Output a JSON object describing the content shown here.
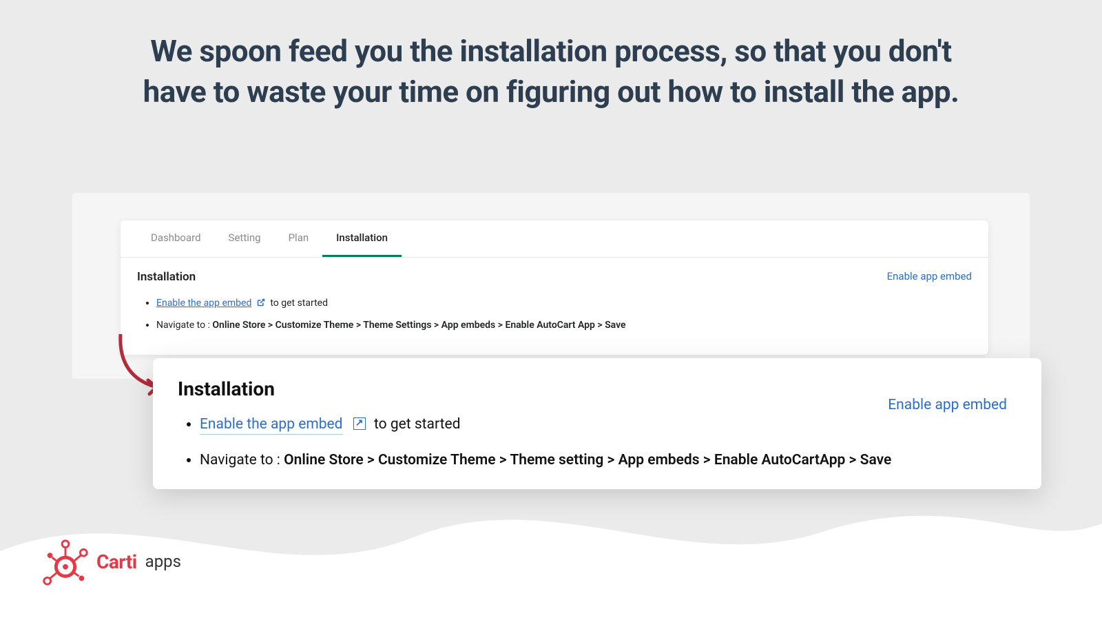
{
  "headline": "We spoon feed you the installation process, so that you don't have to waste your time on figuring out how to install the app.",
  "panel": {
    "tabs": [
      "Dashboard",
      "Setting",
      "Plan",
      "Installation"
    ],
    "activeTab": "Installation",
    "title": "Installation",
    "enableLink": "Enable app embed",
    "steps": {
      "linkText": "Enable the app embed",
      "linkSuffix": "to get started",
      "navPrefix": "Navigate to : ",
      "navPath": "Online Store > Customize Theme > Theme Settings > App embeds > Enable AutoCart App > Save"
    }
  },
  "zoom": {
    "title": "Installation",
    "enableLink": "Enable app embed",
    "linkText": "Enable the app embed",
    "linkSuffix": "to get started",
    "navPrefix": "Navigate to : ",
    "navPath": "Online Store > Customize Theme > Theme setting > App embeds > Enable AutoCartApp > Save"
  },
  "brand": {
    "name": "Carti",
    "sub": "apps"
  },
  "colors": {
    "link": "#2c6ecb",
    "accent": "#008060",
    "brand": "#e63946"
  }
}
